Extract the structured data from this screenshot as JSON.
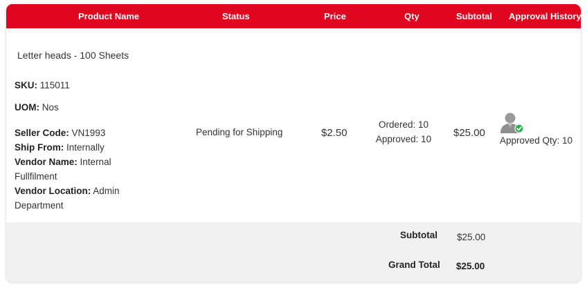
{
  "header": {
    "product_name": "Product Name",
    "status": "Status",
    "price": "Price",
    "qty": "Qty",
    "subtotal": "Subtotal",
    "approval_history": "Approval History"
  },
  "colors": {
    "header_bg": "#e0061f",
    "footer_bg": "#f1f1f1",
    "approved_check": "#22b14c"
  },
  "item": {
    "name": "Letter heads - 100 Sheets",
    "sku_label": "SKU:",
    "sku": "115011",
    "uom_label": "UOM:",
    "uom": "Nos",
    "seller_code_label": "Seller Code:",
    "seller_code": "VN1993",
    "ship_from_label": "Ship From:",
    "ship_from": "Internally",
    "vendor_name_label": "Vendor Name:",
    "vendor_name_line1": "Internal",
    "vendor_name_line2": "Fullfilment",
    "vendor_location_label": "Vendor Location:",
    "vendor_location_line1": "Admin",
    "vendor_location_line2": "Department",
    "status": "Pending for Shipping",
    "price": "$2.50",
    "ordered": "Ordered: 10",
    "approved": "Approved: 10",
    "subtotal": "$25.00",
    "approval_icon": "approved-user-icon",
    "approved_qty": "Approved Qty: 10"
  },
  "totals": {
    "subtotal_label": "Subtotal",
    "subtotal_value": "$25.00",
    "grand_total_label": "Grand Total",
    "grand_total_value": "$25.00"
  }
}
